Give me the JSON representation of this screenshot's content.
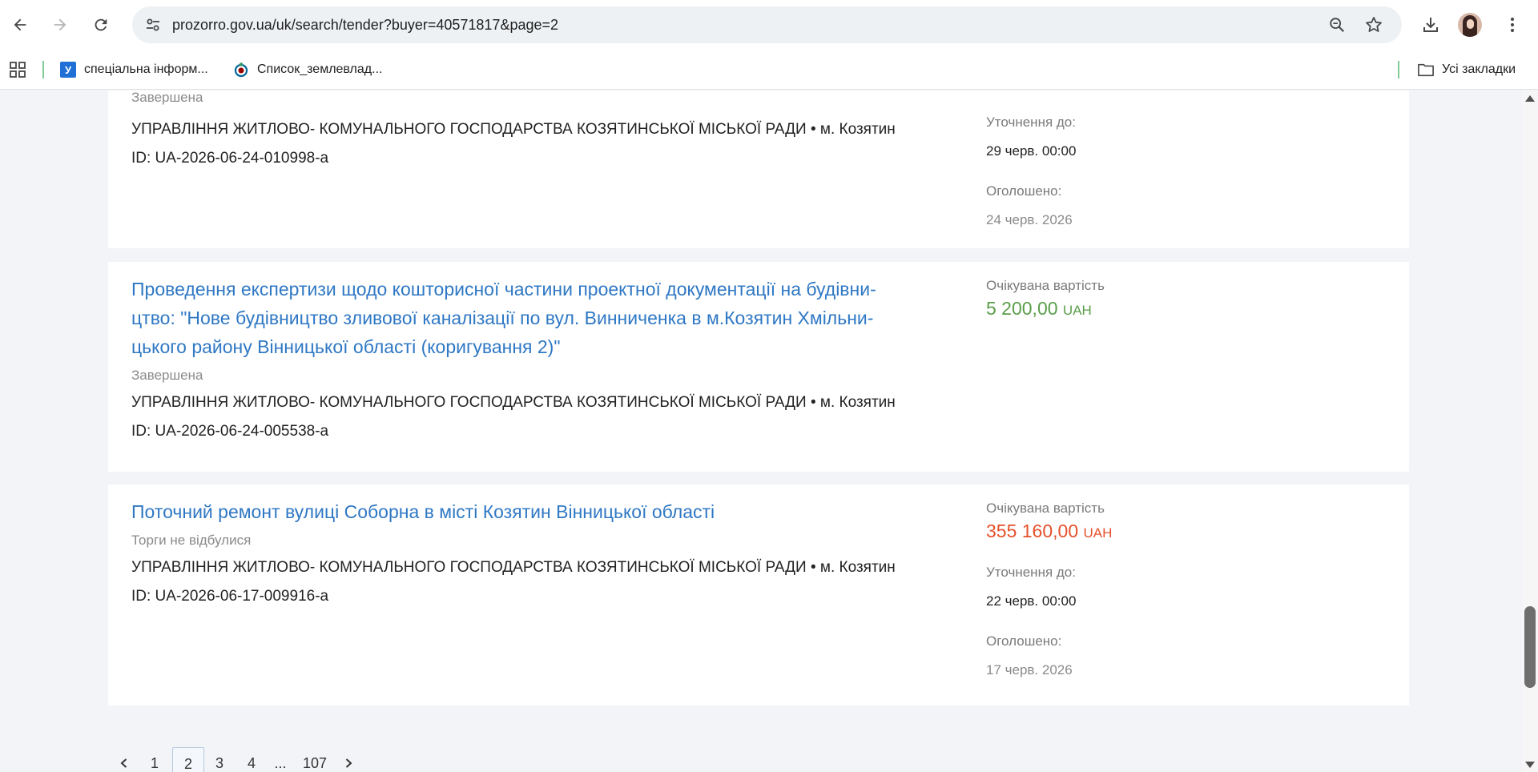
{
  "browser": {
    "url": "prozorro.gov.ua/uk/search/tender?buyer=40571817&page=2",
    "bookmarks": [
      {
        "label": "спеціальна інформ...",
        "favicon": "У"
      },
      {
        "label": "Список_землевлад..."
      }
    ],
    "all_bookmarks_label": "Усі закладки"
  },
  "tenders": [
    {
      "status": "Завершена",
      "buyer": "УПРАВЛІННЯ ЖИТЛОВО- КОМУНАЛЬНОГО ГОСПОДАРСТВА КОЗЯТИНСЬКОЇ МІСЬКОЇ РАДИ • м. Козятин",
      "id": "ID: UA-2026-06-24-010998-a",
      "clarify_label": "Уточнення до:",
      "clarify_date": "29 черв. 00:00",
      "announced_label": "Оголошено:",
      "announced_date": "24 черв. 2026"
    },
    {
      "title_lines": [
        "Проведення експертизи щодо кошторисної частини проектної документації на будівни-",
        "цтво: \"Нове будівництво зливової каналізації по вул. Винниченка в м.Козятин Хмільни-",
        "цького району Вінницької області (коригування 2)\""
      ],
      "status": "Завершена",
      "buyer": "УПРАВЛІННЯ ЖИТЛОВО- КОМУНАЛЬНОГО ГОСПОДАРСТВА КОЗЯТИНСЬКОЇ МІСЬКОЇ РАДИ • м. Козятин",
      "id": "ID: UA-2026-06-24-005538-a",
      "value_label": "Очікувана вартість",
      "value_amount": "5 200,00",
      "value_currency": "UAH",
      "value_color": "#5a9e4a"
    },
    {
      "title_lines": [
        "Поточний ремонт вулиці Соборна в місті Козятин Вінницької області"
      ],
      "status": "Торги не відбулися",
      "buyer": "УПРАВЛІННЯ ЖИТЛОВО- КОМУНАЛЬНОГО ГОСПОДАРСТВА КОЗЯТИНСЬКОЇ МІСЬКОЇ РАДИ • м. Козятин",
      "id": "ID: UA-2026-06-17-009916-a",
      "value_label": "Очікувана вартість",
      "value_amount": "355 160,00",
      "value_currency": "UAH",
      "value_color": "#e5512c",
      "clarify_label": "Уточнення до:",
      "clarify_date": "22 черв. 00:00",
      "announced_label": "Оголошено:",
      "announced_date": "17 черв. 2026"
    }
  ],
  "pagination": {
    "pages": [
      "1",
      "2",
      "3",
      "4",
      "...",
      "107"
    ],
    "current": "2",
    "prev_icon": "chevron-left-icon",
    "next_icon": "chevron-right-icon"
  }
}
